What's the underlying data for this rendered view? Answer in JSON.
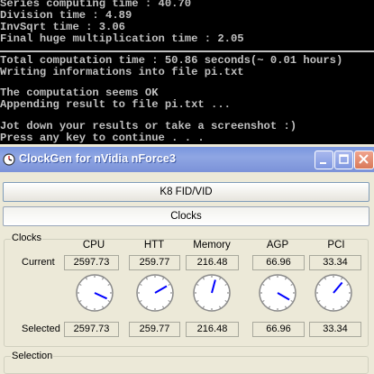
{
  "console": {
    "lines": [
      "Series computing time : 40.70",
      "Division time : 4.89",
      "InvSqrt time : 3.06",
      "Final huge multiplication time : 2.05",
      "Total computation time : 50.86 seconds(~ 0.01 hours)",
      "Writing informations into file pi.txt",
      "",
      "The computation seems OK",
      "Appending result to file pi.txt ...",
      "",
      "Jot down your results or take a screenshot :)",
      "Press any key to continue . . ."
    ]
  },
  "window": {
    "title": "ClockGen for nVidia nForce3",
    "buttons": {
      "k8": "K8 FID/VID",
      "clocks": "Clocks"
    },
    "clocks_group": {
      "label": "Clocks",
      "columns": [
        "CPU",
        "HTT",
        "Memory",
        "AGP",
        "PCI"
      ],
      "current_label": "Current",
      "selected_label": "Selected",
      "current": [
        "2597.73",
        "259.77",
        "216.48",
        "66.96",
        "33.34"
      ],
      "selected": [
        "2597.73",
        "259.77",
        "216.48",
        "66.96",
        "33.34"
      ],
      "dial_angles_deg": [
        115,
        60,
        15,
        120,
        40
      ]
    },
    "selection_group": {
      "label": "Selection"
    }
  },
  "colors": {
    "title_bar": "#7a96df",
    "console_bg": "#000000",
    "console_text": "#c0c0c0",
    "dial_needle": "#0000ff"
  },
  "icons": [
    "clockgen-app-icon",
    "minimize-icon",
    "maximize-icon",
    "close-icon"
  ]
}
